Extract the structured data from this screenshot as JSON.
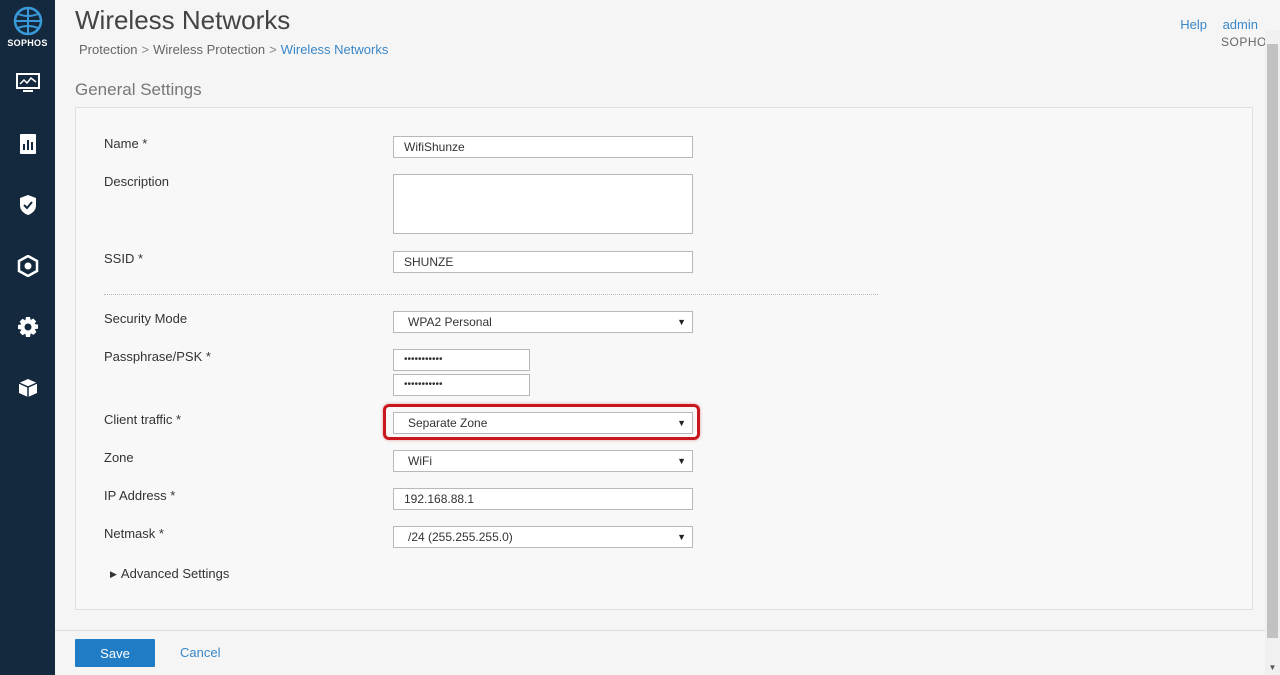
{
  "brand": {
    "logo_text": "SOPHOS",
    "product": "SOPHOS",
    "accent": "#1f7cc5",
    "sidebar_bg": "#14293d",
    "highlight_color": "#c8181e"
  },
  "header": {
    "title": "Wireless Networks",
    "breadcrumb": [
      "Protection",
      "Wireless Protection",
      "Wireless Networks"
    ],
    "breadcrumb_sep": ">",
    "help": "Help",
    "user": "admin"
  },
  "sidebar": {
    "items": [
      {
        "icon": "monitor-icon"
      },
      {
        "icon": "report-icon"
      },
      {
        "icon": "shield-check-icon"
      },
      {
        "icon": "protection-icon"
      },
      {
        "icon": "gear-icon"
      },
      {
        "icon": "box-icon"
      }
    ]
  },
  "section": {
    "title": "General Settings"
  },
  "form": {
    "name_label": "Name *",
    "name_value": "WifiShunze",
    "description_label": "Description",
    "description_value": "",
    "ssid_label": "SSID *",
    "ssid_value": "SHUNZE",
    "security_label": "Security Mode",
    "security_value": "WPA2 Personal",
    "passphrase_label": "Passphrase/PSK *",
    "passphrase_value": "•••••••••••",
    "passphrase_confirm_value": "•••••••••••",
    "client_traffic_label": "Client traffic *",
    "client_traffic_value": "Separate Zone",
    "zone_label": "Zone",
    "zone_value": "WiFi",
    "ip_label": "IP Address *",
    "ip_value": "192.168.88.1",
    "netmask_label": "Netmask *",
    "netmask_value": "/24 (255.255.255.0)",
    "advanced_label": "Advanced Settings"
  },
  "footer": {
    "save_label": "Save",
    "cancel_label": "Cancel"
  }
}
